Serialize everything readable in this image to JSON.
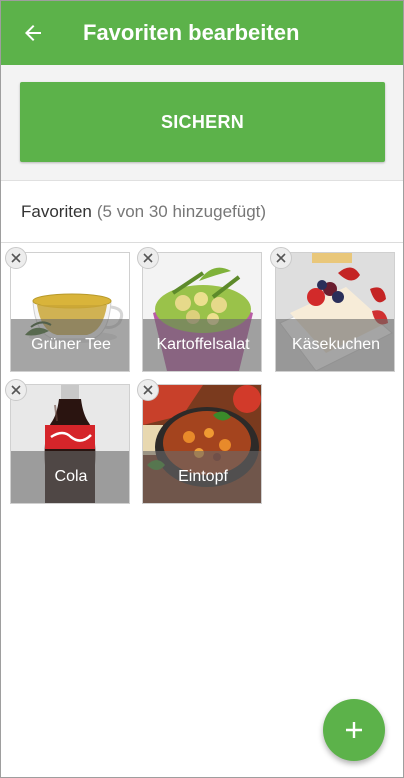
{
  "appbar": {
    "title": "Favoriten bearbeiten",
    "back_icon": "arrow-left-icon"
  },
  "save": {
    "label": "SICHERN"
  },
  "favorites": {
    "label": "Favoriten",
    "count": "(5 von 30 hinzugefügt)",
    "items": [
      {
        "name": "Grüner Tee"
      },
      {
        "name": "Kartoffelsalat"
      },
      {
        "name": "Käsekuchen"
      },
      {
        "name": "Cola"
      },
      {
        "name": "Eintopf"
      }
    ]
  },
  "fab": {
    "icon": "plus-icon"
  },
  "colors": {
    "accent": "#5cb24a"
  }
}
